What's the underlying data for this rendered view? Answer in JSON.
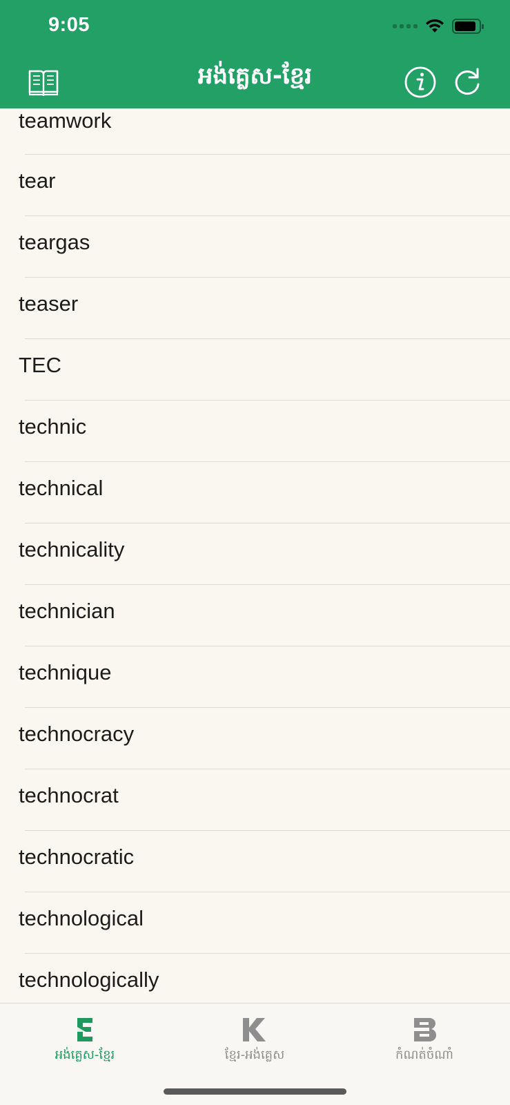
{
  "status_bar": {
    "time": "9:05"
  },
  "nav": {
    "title": "អង់គ្លេស-ខ្មែរ",
    "left_icon": "book-icon",
    "right_icons": [
      "info-icon",
      "refresh-icon"
    ]
  },
  "words": [
    "teamwork",
    "tear",
    "teargas",
    "teaser",
    "TEC",
    "technic",
    "technical",
    "technicality",
    "technician",
    "technique",
    "technocracy",
    "technocrat",
    "technocratic",
    "technological",
    "technologically"
  ],
  "tabs": [
    {
      "label": "អង់គ្លេស-ខ្មែរ",
      "glyph": "E",
      "active": true
    },
    {
      "label": "ខ្មែរ-អង់គ្លេស",
      "glyph": "K",
      "active": false
    },
    {
      "label": "កំណត់ចំណាំ",
      "glyph": "B",
      "active": false
    }
  ],
  "colors": {
    "header_bg": "#23a066",
    "active_tab": "#1e9a5e",
    "inactive_tab": "#8e8e8e",
    "list_bg": "#f9f7f0"
  }
}
